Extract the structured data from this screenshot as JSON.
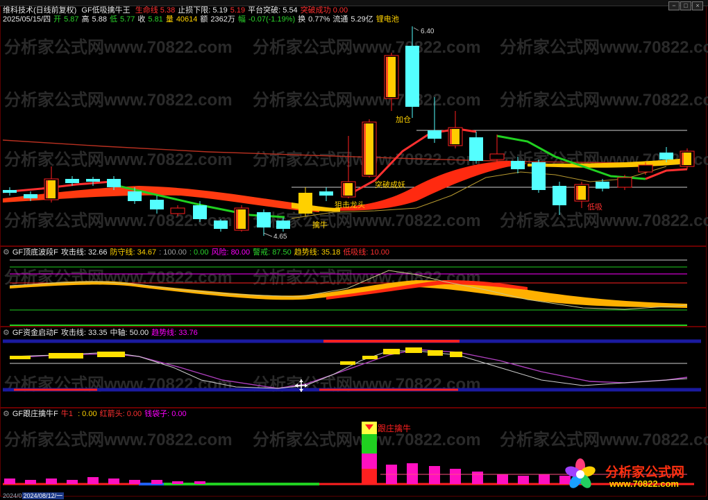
{
  "price_panel": {
    "title": "维科技术(日线前复权)",
    "indicator": "GF低吸擒牛王",
    "fields": [
      {
        "label": "生命线",
        "value": "5.38",
        "color": "r"
      },
      {
        "label": "止损下限:",
        "value": "5.19",
        "color": "w"
      },
      {
        "label": "",
        "value": "5.19",
        "color": "r"
      },
      {
        "label": "平台突破:",
        "value": "5.54",
        "color": "w"
      },
      {
        "label": "突破成功",
        "value": "0.00",
        "color": "r"
      }
    ],
    "quote": {
      "date": "2025/05/15/四",
      "open_label": "开",
      "open": "5.87",
      "high_label": "高",
      "high": "5.88",
      "low_label": "低",
      "low": "5.77",
      "close_label": "收",
      "close": "5.81",
      "vol_label": "量",
      "vol": "40614",
      "amt_label": "额",
      "amt": "2362万",
      "chg_label": "幅",
      "chg": "-0.07(-1.19%)",
      "turn_label": "换",
      "turn": "0.77%",
      "float_label": "流通",
      "float": "5.29亿",
      "concept": "锂电池"
    },
    "annotations": {
      "high": "6.40",
      "low": "4.65",
      "add": "加仓",
      "break": "突破成妖",
      "dragon": "狙击龙头",
      "bull": "擒牛",
      "lowbuy": "低吸"
    }
  },
  "panel2": {
    "name": "GF顶底波段F",
    "fields": [
      {
        "label": "攻击线:",
        "value": "32.66",
        "color": "w"
      },
      {
        "label": "防守线:",
        "value": "34.67",
        "color": "y"
      },
      {
        "label": ":",
        "value": "100.00",
        "color": "gr"
      },
      {
        "label": ":",
        "value": "0.00",
        "color": "g"
      },
      {
        "label": "风险:",
        "value": "80.00",
        "color": "c"
      },
      {
        "label": "警戒:",
        "value": "87.50",
        "color": "g"
      },
      {
        "label": "趋势线:",
        "value": "35.18",
        "color": "y"
      },
      {
        "label": "低吸线:",
        "value": "10.00",
        "color": "r"
      }
    ]
  },
  "panel3": {
    "name": "GF资金启动F",
    "fields": [
      {
        "label": "攻击线:",
        "value": "33.35",
        "color": "w"
      },
      {
        "label": "中轴:",
        "value": "50.00",
        "color": "w"
      },
      {
        "label": "趋势线:",
        "value": "33.76",
        "color": "c"
      }
    ]
  },
  "panel4": {
    "name": "GF跟庄擒牛F",
    "fields": [
      {
        "label": "牛1",
        "value": "",
        "color": "r"
      },
      {
        "label": ":",
        "value": "0.00",
        "color": "y"
      },
      {
        "label": "红箭头:",
        "value": "0.00",
        "color": "r"
      },
      {
        "label": "钱袋子:",
        "value": "0.00",
        "color": "c"
      }
    ],
    "annotation": "跟庄擒牛"
  },
  "watermark": "分析家公式网www.70822.com",
  "logo": {
    "name": "分析家公式网",
    "url": "www.70822.com"
  },
  "date_bar": {
    "left": "2024/0",
    "selected": "2024/08/12/一"
  },
  "window_controls": [
    "−",
    "□",
    "×"
  ],
  "colors": {
    "up": "#ff2020",
    "down": "#54ffff",
    "ma": "#ff3030",
    "accent": "#ffd200",
    "bg": "#000000"
  }
}
